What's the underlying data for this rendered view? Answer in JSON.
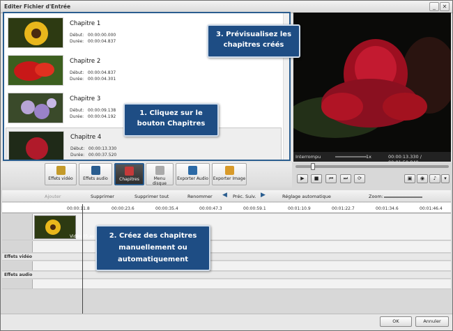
{
  "window": {
    "title": "Editer Fichier d'Entrée"
  },
  "chapters": [
    {
      "name": "Chapitre 1",
      "debut_label": "Début:",
      "debut": "00:00:00.000",
      "duree_label": "Durée:",
      "duree": "00:00:04.837"
    },
    {
      "name": "Chapitre 2",
      "debut_label": "Début:",
      "debut": "00:00:04.837",
      "duree_label": "Durée:",
      "duree": "00:00:04.301"
    },
    {
      "name": "Chapitre 3",
      "debut_label": "Début:",
      "debut": "00:00:09.138",
      "duree_label": "Durée:",
      "duree": "00:00:04.192"
    },
    {
      "name": "Chapitre 4",
      "debut_label": "Début:",
      "debut": "00:00:13.330",
      "duree_label": "Durée:",
      "duree": "00:00:37.520"
    }
  ],
  "callouts": {
    "c3": "3. Prévisualisez les chapitres créés",
    "c1": "1. Cliquez sur le bouton Chapitres",
    "c2": "2. Créez des chapitres manuellement ou automatiquement"
  },
  "preview": {
    "status": "Interrompu",
    "speed": "1x",
    "time": "00:00:13.330 / 00:01:50.840"
  },
  "toolbar": {
    "effets_video": "Effets vidéo",
    "effets_audio": "Effets audio",
    "chapitres": "Chapitres",
    "menu_disque": "Menu disque",
    "exporter_audio": "Exporter Audio",
    "exporter_image": "Exporter Image"
  },
  "timeline": {
    "ajouter": "Ajouter",
    "supprimer": "Supprimer",
    "supprimer_tout": "Supprimer tout",
    "renommer": "Renommer",
    "prec": "Préc.",
    "suiv": "Suiv.",
    "reglage": "Réglage automatique",
    "zoom": "Zoom:",
    "ticks": [
      "00:00:11.8",
      "00:00:23.6",
      "00:00:35.4",
      "00:00:47.3",
      "00:00:59.1",
      "00:01:10.9",
      "00:01:22.7",
      "00:01:34.6",
      "00:01:46.4"
    ],
    "clip_label": "Vidéo 05.avi",
    "effets_video": "Effets vidéo",
    "effets_audio": "Effets audio"
  },
  "footer": {
    "ok": "OK",
    "annuler": "Annuler"
  },
  "colors": {
    "callout": "#1e4d84",
    "accent": "#2a5d8f"
  }
}
